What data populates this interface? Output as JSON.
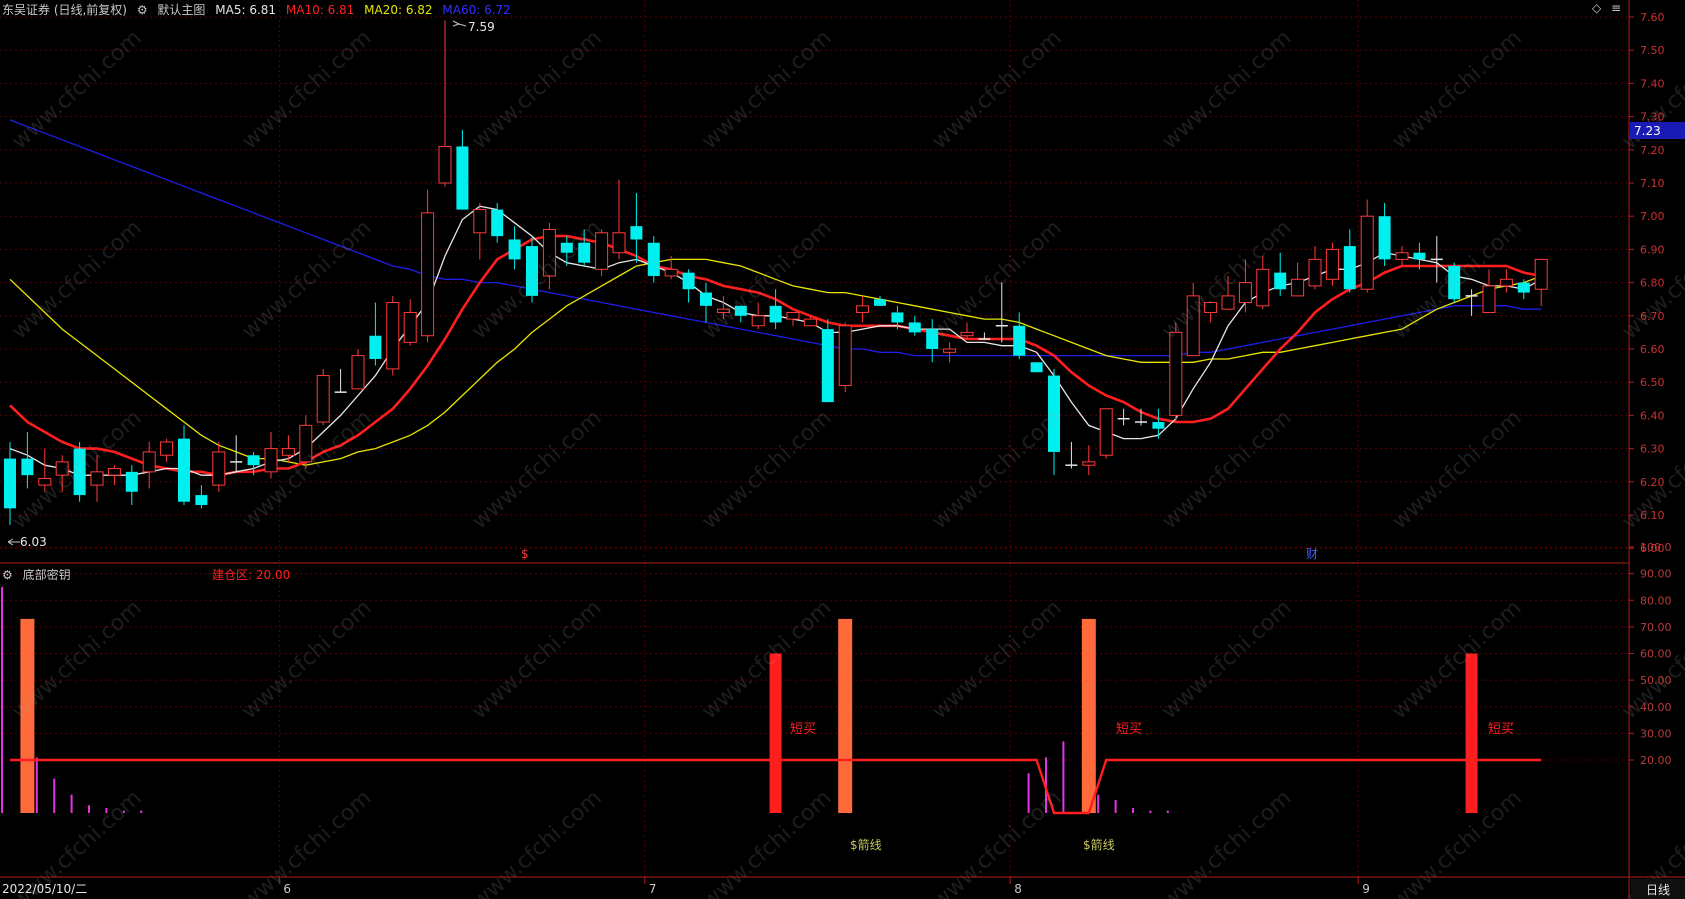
{
  "main_header": {
    "title": "东吴证券 (日线,前复权)",
    "main_chart_label": "默认主图",
    "ma5": "MA5: 6.81",
    "ma10": "MA10: 6.81",
    "ma20": "MA20: 6.82",
    "ma60": "MA60: 6.72"
  },
  "colors": {
    "background": "#000000",
    "grid": "#5a0000",
    "up": "#ff3a3a",
    "down": "#00f0f0",
    "ma5": "#e6e6e6",
    "ma10": "#ff1e1e",
    "ma20": "#e6e600",
    "ma60": "#1e1ee6",
    "bar_orange": "#ff6a3a",
    "bar_red": "#ff1e1e",
    "bar_magenta": "#e632e6",
    "signal_line": "#ff1e1e"
  },
  "price_axis": {
    "ticks": [
      "7.60",
      "7.50",
      "7.40",
      "7.30",
      "7.20",
      "7.10",
      "7.00",
      "6.90",
      "6.80",
      "6.70",
      "6.60",
      "6.50",
      "6.40",
      "6.30",
      "6.20",
      "6.10",
      "6.00"
    ],
    "current_price": "7.23",
    "high_marker": "7.59",
    "low_marker": "6.03"
  },
  "markers": {
    "dividend": "$",
    "finance": "财"
  },
  "indicator": {
    "name": "底部密钥",
    "param_label": "建仓区: 20.00",
    "ticks": [
      "100.0",
      "90.00",
      "80.00",
      "70.00",
      "60.00",
      "50.00",
      "40.00",
      "30.00",
      "20.00"
    ],
    "labels": [
      "短买",
      "短买",
      "短买",
      "$箭线",
      "$箭线"
    ]
  },
  "time_axis": {
    "start_date": "2022/05/10/二",
    "months": [
      "6",
      "7",
      "8",
      "9"
    ],
    "period": "日线"
  },
  "watermark": "www.cfchi.com",
  "candles": [
    [
      6.27,
      6.12,
      6.32,
      6.07
    ],
    [
      6.27,
      6.22,
      6.35,
      6.18
    ],
    [
      6.19,
      6.21,
      6.3,
      6.17
    ],
    [
      6.22,
      6.26,
      6.28,
      6.17
    ],
    [
      6.3,
      6.16,
      6.32,
      6.14
    ],
    [
      6.19,
      6.23,
      6.28,
      6.14
    ],
    [
      6.22,
      6.24,
      6.25,
      6.19
    ],
    [
      6.23,
      6.17,
      6.25,
      6.13
    ],
    [
      6.23,
      6.29,
      6.32,
      6.18
    ],
    [
      6.28,
      6.32,
      6.33,
      6.26
    ],
    [
      6.33,
      6.14,
      6.37,
      6.13
    ],
    [
      6.16,
      6.13,
      6.19,
      6.12
    ],
    [
      6.19,
      6.29,
      6.32,
      6.17
    ],
    [
      6.26,
      6.26,
      6.34,
      6.23
    ],
    [
      6.28,
      6.25,
      6.29,
      6.22
    ],
    [
      6.23,
      6.3,
      6.35,
      6.21
    ],
    [
      6.28,
      6.3,
      6.34,
      6.26
    ],
    [
      6.26,
      6.37,
      6.4,
      6.24
    ],
    [
      6.38,
      6.52,
      6.54,
      6.37
    ],
    [
      6.47,
      6.47,
      6.54,
      6.47
    ],
    [
      6.48,
      6.58,
      6.6,
      6.48
    ],
    [
      6.64,
      6.57,
      6.74,
      6.55
    ],
    [
      6.54,
      6.74,
      6.76,
      6.52
    ],
    [
      6.62,
      6.71,
      6.75,
      6.61
    ],
    [
      6.64,
      7.01,
      7.08,
      6.62
    ],
    [
      7.1,
      7.21,
      7.59,
      7.09
    ],
    [
      7.21,
      7.02,
      7.26,
      7.02
    ],
    [
      6.95,
      7.02,
      7.04,
      6.87
    ],
    [
      7.02,
      6.94,
      7.04,
      6.92
    ],
    [
      6.93,
      6.87,
      6.97,
      6.84
    ],
    [
      6.91,
      6.76,
      6.94,
      6.74
    ],
    [
      6.82,
      6.96,
      6.98,
      6.78
    ],
    [
      6.92,
      6.89,
      6.94,
      6.85
    ],
    [
      6.92,
      6.86,
      6.96,
      6.85
    ],
    [
      6.84,
      6.95,
      6.96,
      6.82
    ],
    [
      6.89,
      6.95,
      7.11,
      6.87
    ],
    [
      6.97,
      6.93,
      7.07,
      6.86
    ],
    [
      6.92,
      6.82,
      6.94,
      6.8
    ],
    [
      6.82,
      6.84,
      6.88,
      6.81
    ],
    [
      6.83,
      6.78,
      6.84,
      6.74
    ],
    [
      6.77,
      6.73,
      6.8,
      6.68
    ],
    [
      6.71,
      6.72,
      6.76,
      6.69
    ],
    [
      6.73,
      6.7,
      6.73,
      6.68
    ],
    [
      6.67,
      6.7,
      6.74,
      6.66
    ],
    [
      6.73,
      6.68,
      6.78,
      6.66
    ],
    [
      6.69,
      6.71,
      6.71,
      6.67
    ],
    [
      6.67,
      6.69,
      6.7,
      6.67
    ],
    [
      6.66,
      6.44,
      6.69,
      6.44
    ],
    [
      6.49,
      6.67,
      6.68,
      6.47
    ],
    [
      6.71,
      6.73,
      6.76,
      6.68
    ],
    [
      6.75,
      6.73,
      6.76,
      6.73
    ],
    [
      6.71,
      6.68,
      6.73,
      6.66
    ],
    [
      6.68,
      6.65,
      6.7,
      6.64
    ],
    [
      6.66,
      6.6,
      6.69,
      6.56
    ],
    [
      6.59,
      6.6,
      6.62,
      6.56
    ],
    [
      6.64,
      6.65,
      6.68,
      6.63
    ],
    [
      6.63,
      6.63,
      6.65,
      6.63
    ],
    [
      6.67,
      6.67,
      6.8,
      6.62
    ],
    [
      6.67,
      6.58,
      6.71,
      6.57
    ],
    [
      6.56,
      6.53,
      6.56,
      6.55
    ],
    [
      6.52,
      6.29,
      6.54,
      6.22
    ],
    [
      6.25,
      6.25,
      6.32,
      6.24
    ],
    [
      6.25,
      6.26,
      6.31,
      6.22
    ],
    [
      6.28,
      6.42,
      6.42,
      6.27
    ],
    [
      6.39,
      6.39,
      6.42,
      6.37
    ],
    [
      6.38,
      6.38,
      6.42,
      6.37
    ],
    [
      6.38,
      6.36,
      6.42,
      6.33
    ],
    [
      6.4,
      6.65,
      6.68,
      6.38
    ],
    [
      6.58,
      6.76,
      6.8,
      6.58
    ],
    [
      6.71,
      6.74,
      6.74,
      6.68
    ],
    [
      6.72,
      6.76,
      6.82,
      6.72
    ],
    [
      6.74,
      6.8,
      6.87,
      6.71
    ],
    [
      6.73,
      6.84,
      6.88,
      6.72
    ],
    [
      6.83,
      6.78,
      6.89,
      6.76
    ],
    [
      6.76,
      6.81,
      6.86,
      6.76
    ],
    [
      6.79,
      6.87,
      6.91,
      6.78
    ],
    [
      6.81,
      6.9,
      6.92,
      6.79
    ],
    [
      6.91,
      6.78,
      6.96,
      6.77
    ],
    [
      6.78,
      7.0,
      7.05,
      6.77
    ],
    [
      7.0,
      6.87,
      7.04,
      6.85
    ],
    [
      6.87,
      6.89,
      6.91,
      6.85
    ],
    [
      6.89,
      6.87,
      6.92,
      6.84
    ],
    [
      6.87,
      6.87,
      6.94,
      6.8
    ],
    [
      6.85,
      6.75,
      6.86,
      6.74
    ],
    [
      6.76,
      6.76,
      6.78,
      6.7
    ],
    [
      6.71,
      6.79,
      6.84,
      6.71
    ],
    [
      6.79,
      6.81,
      6.84,
      6.77
    ],
    [
      6.8,
      6.77,
      6.81,
      6.75
    ],
    [
      6.78,
      6.87,
      6.87,
      6.73
    ]
  ],
  "moving_averages": {
    "ma5": [
      6.3,
      6.28,
      6.25,
      6.24,
      6.22,
      6.22,
      6.22,
      6.22,
      6.23,
      6.24,
      6.24,
      6.22,
      6.22,
      6.23,
      6.24,
      6.26,
      6.27,
      6.3,
      6.35,
      6.4,
      6.46,
      6.52,
      6.6,
      6.67,
      6.74,
      6.88,
      6.99,
      7.03,
      7.02,
      6.98,
      6.94,
      6.89,
      6.86,
      6.85,
      6.84,
      6.86,
      6.87,
      6.85,
      6.83,
      6.8,
      6.76,
      6.74,
      6.71,
      6.7,
      6.7,
      6.69,
      6.68,
      6.65,
      6.65,
      6.66,
      6.67,
      6.67,
      6.66,
      6.66,
      6.66,
      6.62,
      6.62,
      6.61,
      6.61,
      6.59,
      6.52,
      6.44,
      6.37,
      6.35,
      6.33,
      6.33,
      6.34,
      6.39,
      6.48,
      6.56,
      6.67,
      6.74,
      6.77,
      6.79,
      6.8,
      6.82,
      6.84,
      6.84,
      6.86,
      6.89,
      6.88,
      6.87,
      6.86,
      6.82,
      6.81,
      6.79,
      6.79,
      6.78,
      6.81
    ],
    "ma10": [
      6.43,
      6.38,
      6.35,
      6.32,
      6.3,
      6.3,
      6.29,
      6.27,
      6.25,
      6.24,
      6.23,
      6.23,
      6.22,
      6.23,
      6.23,
      6.24,
      6.24,
      6.26,
      6.29,
      6.31,
      6.34,
      6.38,
      6.42,
      6.48,
      6.55,
      6.63,
      6.72,
      6.8,
      6.87,
      6.9,
      6.93,
      6.94,
      6.94,
      6.93,
      6.92,
      6.9,
      6.88,
      6.85,
      6.84,
      6.82,
      6.81,
      6.79,
      6.78,
      6.77,
      6.75,
      6.72,
      6.7,
      6.68,
      6.67,
      6.67,
      6.67,
      6.67,
      6.66,
      6.65,
      6.64,
      6.63,
      6.63,
      6.63,
      6.63,
      6.61,
      6.58,
      6.53,
      6.49,
      6.46,
      6.44,
      6.41,
      6.39,
      6.38,
      6.38,
      6.39,
      6.42,
      6.48,
      6.54,
      6.6,
      6.65,
      6.71,
      6.75,
      6.78,
      6.8,
      6.83,
      6.85,
      6.85,
      6.85,
      6.85,
      6.85,
      6.85,
      6.85,
      6.83,
      6.82
    ],
    "ma20": [
      6.81,
      6.76,
      6.71,
      6.66,
      6.62,
      6.58,
      6.54,
      6.5,
      6.46,
      6.42,
      6.38,
      6.34,
      6.31,
      6.29,
      6.27,
      6.27,
      6.26,
      6.25,
      6.26,
      6.27,
      6.29,
      6.3,
      6.32,
      6.34,
      6.37,
      6.41,
      6.46,
      6.51,
      6.56,
      6.6,
      6.65,
      6.69,
      6.73,
      6.76,
      6.79,
      6.82,
      6.85,
      6.86,
      6.87,
      6.87,
      6.87,
      6.86,
      6.85,
      6.83,
      6.81,
      6.79,
      6.78,
      6.77,
      6.77,
      6.76,
      6.75,
      6.74,
      6.73,
      6.72,
      6.71,
      6.7,
      6.69,
      6.69,
      6.68,
      6.66,
      6.64,
      6.62,
      6.6,
      6.58,
      6.57,
      6.56,
      6.56,
      6.56,
      6.56,
      6.57,
      6.57,
      6.58,
      6.59,
      6.59,
      6.6,
      6.61,
      6.62,
      6.63,
      6.64,
      6.65,
      6.66,
      6.69,
      6.72,
      6.74,
      6.76,
      6.78,
      6.79,
      6.8,
      6.82
    ],
    "ma60": [
      7.29,
      7.27,
      7.25,
      7.23,
      7.21,
      7.19,
      7.17,
      7.15,
      7.13,
      7.11,
      7.09,
      7.07,
      7.05,
      7.03,
      7.01,
      6.99,
      6.97,
      6.95,
      6.93,
      6.91,
      6.89,
      6.87,
      6.85,
      6.84,
      6.82,
      6.81,
      6.81,
      6.8,
      6.8,
      6.79,
      6.78,
      6.77,
      6.76,
      6.75,
      6.74,
      6.73,
      6.72,
      6.71,
      6.7,
      6.69,
      6.68,
      6.67,
      6.66,
      6.65,
      6.64,
      6.63,
      6.62,
      6.61,
      6.6,
      6.6,
      6.59,
      6.59,
      6.58,
      6.58,
      6.58,
      6.58,
      6.58,
      6.58,
      6.58,
      6.58,
      6.58,
      6.58,
      6.58,
      6.58,
      6.58,
      6.58,
      6.58,
      6.58,
      6.59,
      6.59,
      6.6,
      6.61,
      6.62,
      6.63,
      6.64,
      6.65,
      6.66,
      6.67,
      6.68,
      6.69,
      6.7,
      6.71,
      6.72,
      6.73,
      6.73,
      6.73,
      6.73,
      6.72,
      6.72
    ]
  },
  "indicator_bars": {
    "orange": [
      [
        1,
        73
      ],
      [
        48,
        73
      ],
      [
        62,
        73
      ]
    ],
    "red": [
      [
        44,
        60
      ],
      [
        84,
        60
      ]
    ],
    "magenta": [
      [
        0,
        85
      ],
      [
        2,
        21
      ],
      [
        3,
        13
      ],
      [
        4,
        7
      ],
      [
        5,
        3
      ],
      [
        6,
        2
      ],
      [
        7,
        1
      ],
      [
        8,
        1
      ],
      [
        59,
        15
      ],
      [
        60,
        21
      ],
      [
        61,
        27
      ],
      [
        63,
        7
      ],
      [
        64,
        5
      ],
      [
        65,
        2
      ],
      [
        66,
        1
      ],
      [
        67,
        1
      ]
    ],
    "signal": [
      20,
      20,
      20,
      20,
      20,
      20,
      20,
      20,
      20,
      20,
      20,
      20,
      20,
      20,
      20,
      20,
      20,
      20,
      20,
      20,
      20,
      20,
      20,
      20,
      20,
      20,
      20,
      20,
      20,
      20,
      20,
      20,
      20,
      20,
      20,
      20,
      20,
      20,
      20,
      20,
      20,
      20,
      20,
      20,
      20,
      20,
      20,
      20,
      20,
      20,
      20,
      20,
      20,
      20,
      20,
      20,
      20,
      20,
      20,
      20,
      0,
      0,
      0,
      20,
      20,
      20,
      20,
      20,
      20,
      20,
      20,
      20,
      20,
      20,
      20,
      20,
      20,
      20,
      20,
      20,
      20,
      20,
      20,
      20,
      20,
      20,
      20,
      20,
      20
    ]
  }
}
